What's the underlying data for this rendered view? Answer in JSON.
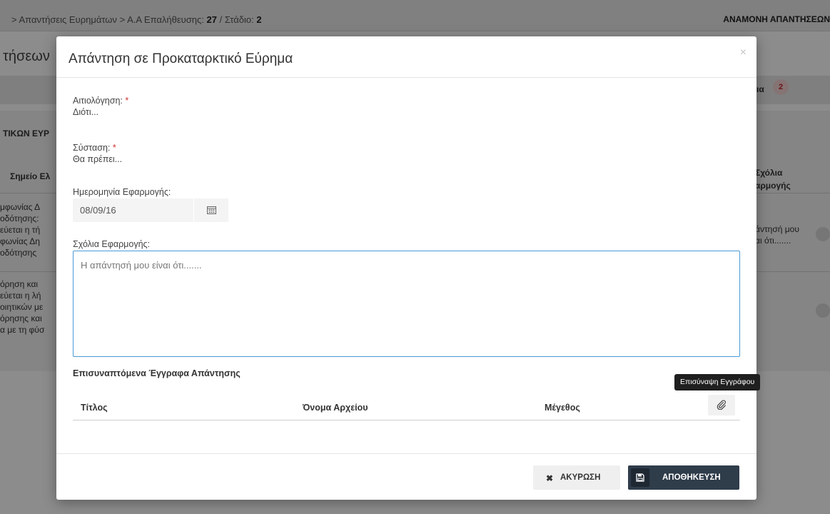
{
  "background": {
    "breadcrumb": {
      "sep": ">",
      "item1": "Απαντήσεις Ευρημάτων",
      "item2_prefix": "Α.Α Επαλήθευσης:",
      "item2_num": "27",
      "item2_stage_prefix": "/ Στάδιο:",
      "item2_stage": "2"
    },
    "status": "ΑΝΑΜΟΝΗ ΑΠΑΝΤΗΣΕΩΝ",
    "page_title": "τήσεων",
    "bar_text": "ια",
    "badge_count": "2",
    "section_title": "ΤΙΚΩΝ ΕΥΡ",
    "col_left_header": "Σημείο Ελ",
    "col_right_header": "Σχόλια\nαρμογής",
    "row1_left": "μφωνίας Δ\nοδότησης:\nεύεται η τή\nφωνίας Δη\nοδότησης",
    "row1_right": "άντησή μου\nαι ότι.......",
    "row2_left": "όρηση και\nεύεται η λή\nοιητικών με\nόρησης και\nα με τη φύσ"
  },
  "modal": {
    "title": "Απάντηση σε Προκαταρκτικό Εύρημα",
    "close_glyph": "×",
    "reasoning_label": "Αιτιολόγηση:",
    "reasoning_value": "Διότι...",
    "recommendation_label": "Σύσταση:",
    "recommendation_value": "Θα πρέπει...",
    "required_mark": "*",
    "date_label": "Ημερομηνία Εφαρμογής:",
    "date_value": "08/09/16",
    "comments_label": "Σχόλια Εφαρμογής:",
    "comments_placeholder": "Η απάντησή μου είναι ότι.......",
    "attachments_title": "Επισυναπτόμενα Έγγραφα Απάντησης",
    "table_headers": {
      "title": "Τίτλος",
      "filename": "Όνομα Αρχείου",
      "size": "Μέγεθος"
    },
    "attach_tooltip": "Επισύναψη Εγγράφου",
    "cancel_label": "ΑΚΥΡΩΣΗ",
    "save_label": "ΑΠΟΘΗΚΕΥΣΗ"
  },
  "icons": {
    "calendar": "calendar-icon",
    "paperclip": "paperclip-icon",
    "cancel": "x-icon",
    "save": "floppy-disk-icon",
    "close": "close-icon"
  },
  "colors": {
    "accent_border": "#4a9bd6",
    "required": "#d0302f",
    "save_button": "#2f3c4a",
    "badge_text": "#c0282e"
  }
}
